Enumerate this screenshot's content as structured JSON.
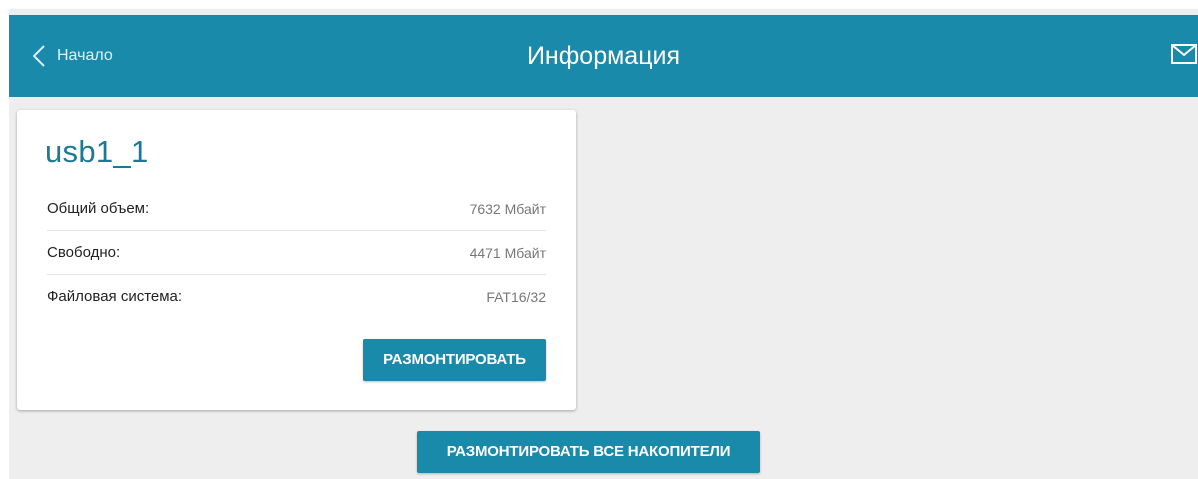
{
  "header": {
    "back_label": "Начало",
    "title": "Информация",
    "back_icon": "chevron-left-icon",
    "mail_icon": "envelope-icon",
    "bg_color": "#1a8aab"
  },
  "device": {
    "name": "usb1_1",
    "rows": [
      {
        "label": "Общий объем:",
        "value": "7632 Мбайт"
      },
      {
        "label": "Свободно:",
        "value": "4471 Мбайт"
      },
      {
        "label": "Файловая система:",
        "value": "FAT16/32"
      }
    ],
    "unmount_label": "РАЗМОНТИРОВАТЬ"
  },
  "actions": {
    "unmount_all_label": "РАЗМОНТИРОВАТЬ ВСЕ НАКОПИТЕЛИ"
  },
  "colors": {
    "accent": "#1a8aab",
    "title_text": "#1a7a96",
    "background": "#eeeeee"
  }
}
